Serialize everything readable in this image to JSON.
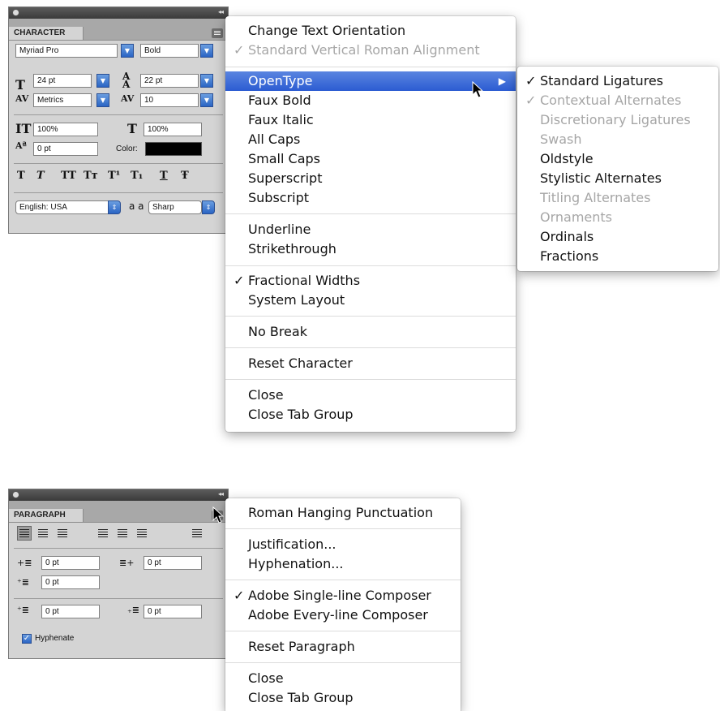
{
  "character_panel": {
    "tab": "CHARACTER",
    "font_family": "Myriad Pro",
    "font_style": "Bold",
    "font_size": "24 pt",
    "leading": "22 pt",
    "kerning": "Metrics",
    "tracking": "10",
    "vertical_scale": "100%",
    "horizontal_scale": "100%",
    "baseline_shift": "0 pt",
    "color_label": "Color:",
    "color_swatch": "#000000",
    "type_style_buttons": [
      "T",
      "T",
      "TT",
      "Tт",
      "T¹",
      "T₁",
      "T",
      "Ŧ"
    ],
    "language": "English: USA",
    "aa_label": "a a",
    "antialias": "Sharp"
  },
  "character_menu": {
    "items": [
      {
        "label": "Change Text Orientation",
        "checked": false,
        "disabled": false
      },
      {
        "label": "Standard Vertical Roman Alignment",
        "checked": true,
        "disabled": true
      },
      {
        "label": "OpenType",
        "checked": false,
        "disabled": false,
        "highlighted": true,
        "submenu": true
      },
      {
        "label": "Faux Bold"
      },
      {
        "label": "Faux Italic"
      },
      {
        "label": "All Caps"
      },
      {
        "label": "Small Caps"
      },
      {
        "label": "Superscript"
      },
      {
        "label": "Subscript"
      },
      {
        "label": "Underline"
      },
      {
        "label": "Strikethrough"
      },
      {
        "label": "Fractional Widths",
        "checked": true
      },
      {
        "label": "System Layout"
      },
      {
        "label": "No Break"
      },
      {
        "label": "Reset Character"
      },
      {
        "label": "Close"
      },
      {
        "label": "Close Tab Group"
      }
    ],
    "check_glyph": "✓",
    "arrow_glyph": "▶"
  },
  "opentype_submenu": {
    "items": [
      {
        "label": "Standard Ligatures",
        "checked": true,
        "disabled": false
      },
      {
        "label": "Contextual Alternates",
        "checked": true,
        "disabled": true
      },
      {
        "label": "Discretionary Ligatures",
        "disabled": true
      },
      {
        "label": "Swash",
        "disabled": true
      },
      {
        "label": "Oldstyle",
        "disabled": false
      },
      {
        "label": "Stylistic Alternates",
        "disabled": false
      },
      {
        "label": "Titling Alternates",
        "disabled": true
      },
      {
        "label": "Ornaments",
        "disabled": true
      },
      {
        "label": "Ordinals",
        "disabled": false
      },
      {
        "label": "Fractions",
        "disabled": false
      }
    ]
  },
  "paragraph_panel": {
    "tab": "PARAGRAPH",
    "indent_left": "0 pt",
    "indent_right": "0 pt",
    "indent_first": "0 pt",
    "space_before": "0 pt",
    "space_after": "0 pt",
    "hyphenate_label": "Hyphenate",
    "hyphenate_checked": true
  },
  "paragraph_menu": {
    "items": [
      {
        "label": "Roman Hanging Punctuation"
      },
      {
        "label": "Justification..."
      },
      {
        "label": "Hyphenation..."
      },
      {
        "label": "Adobe Single-line Composer",
        "checked": true
      },
      {
        "label": "Adobe Every-line Composer"
      },
      {
        "label": "Reset Paragraph"
      },
      {
        "label": "Close"
      },
      {
        "label": "Close Tab Group"
      }
    ]
  }
}
